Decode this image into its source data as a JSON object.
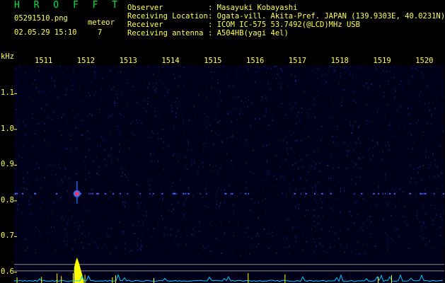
{
  "app": {
    "title": "H R O F F T",
    "file_name": "05291510.png",
    "timestamp": "02.05.29 15:10",
    "count_label": "meteor",
    "count_value": "7"
  },
  "info": [
    {
      "label": "Observer",
      "value": ": Masayuki Kobayashi"
    },
    {
      "label": "Receiving Location",
      "value": ": Ogata-vill. Akita-Pref. JAPAN (139.9303E, 40.0231N)"
    },
    {
      "label": "Receiver",
      "value": ": ICOM IC-575 53.7492(@LCD)MHz USB"
    },
    {
      "label": "Receiving antenna",
      "value": ": A504HB(yagi 4el)"
    }
  ],
  "colors": {
    "background": "#000000",
    "plot_bg": "#000018",
    "text": "#ffff55",
    "title": "#00e640",
    "echo_core": "#ff3060",
    "echo_halo": "#3070ff",
    "baseline_trace": "#00c8ff",
    "peak": "#ffff00"
  },
  "chart_data": {
    "type": "heatmap",
    "title": "",
    "xlabel": "",
    "ylabel": "kHz",
    "x_ticks": [
      "1511",
      "1512",
      "1513",
      "1514",
      "1515",
      "1516",
      "1517",
      "1518",
      "1519",
      "1520"
    ],
    "y_ticks": [
      "1.1",
      "1.0",
      "0.9",
      "0.8",
      "0.7",
      "0.6"
    ],
    "y_range": [
      0.57,
      1.18
    ],
    "events": [
      {
        "time": 1512.0,
        "freq_khz": 0.82,
        "intensity": "strong"
      }
    ],
    "carrier_freq_khz": 0.82,
    "grid": false
  }
}
